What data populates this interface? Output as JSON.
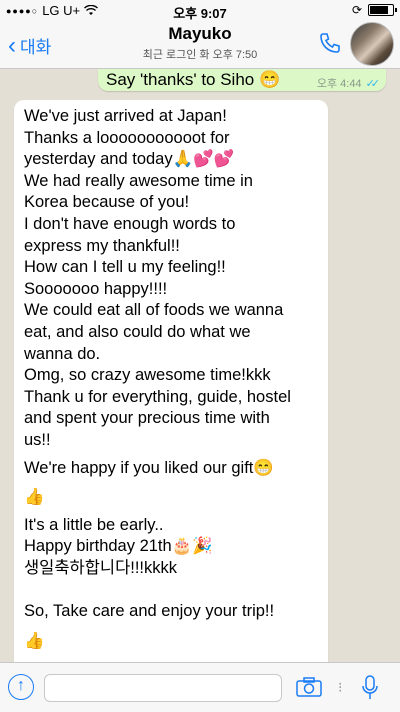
{
  "status_bar": {
    "carrier": "LG U+",
    "time": "오후 9:07",
    "battery_level": 0.85
  },
  "header": {
    "back_label": "대화",
    "contact_name": "Mayuko",
    "last_seen": "최근 로그인 화 오후 7:50"
  },
  "outgoing": {
    "text": "Say 'thanks' to Siho 😁",
    "time": "오후 4:44"
  },
  "incoming": {
    "lines": [
      "We've just arrived at Japan!",
      "Thanks a looooooooooot for",
      "yesterday and today🙏💕💕",
      "We had really awesome time in",
      "Korea because of you!",
      "I don't have enough words to",
      "express my thankful!!",
      "How can I tell u my feeling!!",
      "Sooooooo happy!!!!",
      "We could eat all of foods we wanna",
      "eat, and also could do what we",
      "wanna do.",
      "Omg, so crazy awesome time!kkk",
      "Thank u for everything, guide, hostel",
      "and spent your precious time with",
      "us!!",
      "We're happy if you liked our gift😁",
      "👍",
      "It's a little be early..",
      "Happy birthday 21th🎂🎉",
      "생일축하합니다!!!kkkk",
      "",
      "So, Take care and enjoy your trip!!",
      "👍"
    ]
  }
}
